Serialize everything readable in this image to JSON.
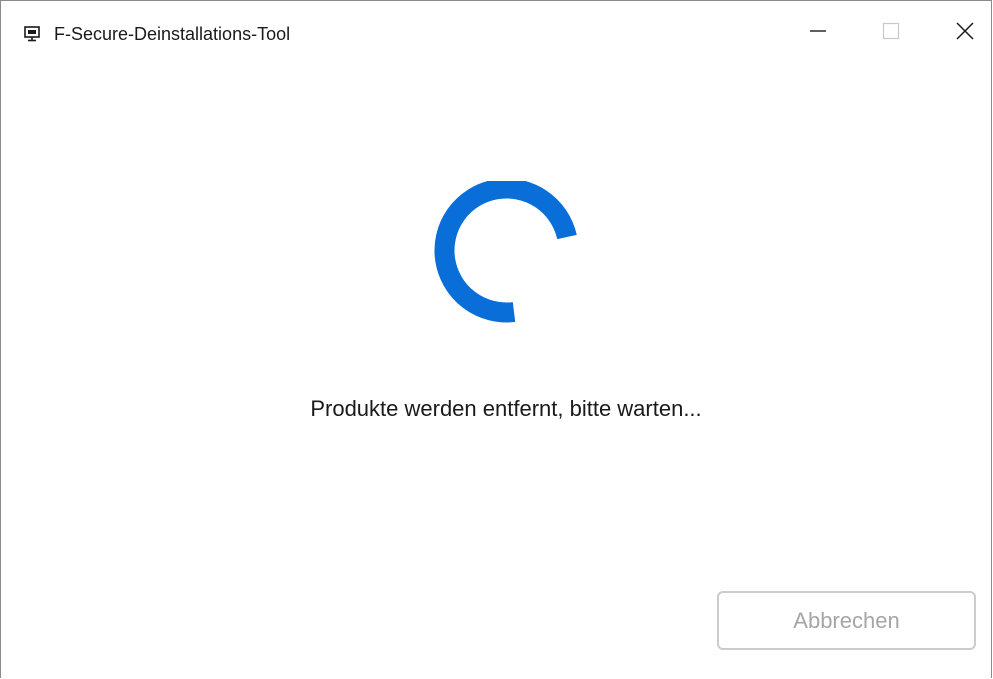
{
  "window": {
    "title": "F-Secure-Deinstallations-Tool",
    "icon": "monitor-app-icon"
  },
  "controls": {
    "minimize_icon": "minimize-icon",
    "maximize_icon": "maximize-icon",
    "close_icon": "close-icon"
  },
  "progress": {
    "status_text": "Produkte werden entfernt, bitte warten...",
    "spinner_color": "#0a6ed8"
  },
  "actions": {
    "cancel_label": "Abbrechen",
    "cancel_enabled": false
  }
}
